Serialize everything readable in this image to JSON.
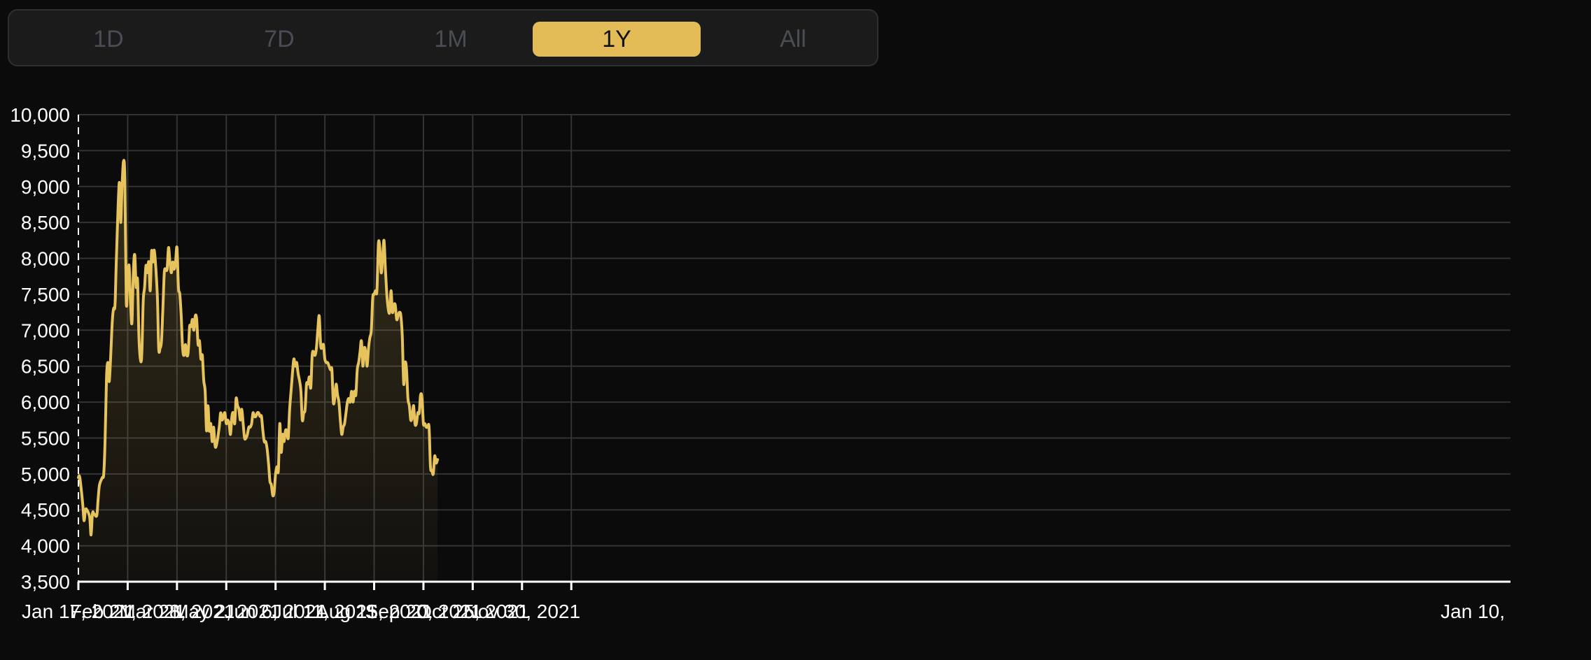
{
  "range_tabs": {
    "items": [
      {
        "label": "1D"
      },
      {
        "label": "7D"
      },
      {
        "label": "1M"
      },
      {
        "label": "1Y"
      },
      {
        "label": "All"
      }
    ],
    "active": "1Y"
  },
  "colors": {
    "line": "#e6c35c",
    "background": "#0b0b0b",
    "grid": "#333333",
    "active_tab": "#e3bc57",
    "inactive_tab_text": "#4b4d55"
  },
  "chart_data": {
    "type": "area",
    "title": "",
    "xlabel": "",
    "ylabel": "",
    "ylim": [
      3500,
      10000
    ],
    "grid": true,
    "yticks": [
      {
        "value": 10000,
        "label": "10,000"
      },
      {
        "value": 9500,
        "label": "9,500"
      },
      {
        "value": 9000,
        "label": "9,000"
      },
      {
        "value": 8500,
        "label": "8,500"
      },
      {
        "value": 8000,
        "label": "8,000"
      },
      {
        "value": 7500,
        "label": "7,500"
      },
      {
        "value": 7000,
        "label": "7,000"
      },
      {
        "value": 6500,
        "label": "6,500"
      },
      {
        "value": 6000,
        "label": "6,000"
      },
      {
        "value": 5500,
        "label": "5,500"
      },
      {
        "value": 5000,
        "label": "5,000"
      },
      {
        "value": 4500,
        "label": "4,500"
      },
      {
        "value": 4000,
        "label": "4,000"
      },
      {
        "value": 3500,
        "label": "3,500"
      }
    ],
    "xticks": [
      {
        "label": "Jan 17, 2021",
        "day": 0
      },
      {
        "label": "Feb 21, 2021",
        "day": 35
      },
      {
        "label": "Mar 28, 2021",
        "day": 70
      },
      {
        "label": "May 2, 2021",
        "day": 105
      },
      {
        "label": "Jun 6, 2021",
        "day": 140
      },
      {
        "label": "Jul 11, 2021",
        "day": 175
      },
      {
        "label": "Aug 15, 2021",
        "day": 210
      },
      {
        "label": "Sep 20, 2021",
        "day": 245
      },
      {
        "label": "Oct 25, 2021",
        "day": 280
      },
      {
        "label": "Nov 30, 2021",
        "day": 315
      },
      {
        "label": "Jan 10,",
        "day": 350
      }
    ],
    "series": [
      {
        "values": [
          [
            0,
            4950
          ],
          [
            1,
            4950
          ],
          [
            3,
            4600
          ],
          [
            4,
            4350
          ],
          [
            5,
            4500
          ],
          [
            6,
            4500
          ],
          [
            8,
            4400
          ],
          [
            9,
            4150
          ],
          [
            10,
            4450
          ],
          [
            11,
            4450
          ],
          [
            13,
            4420
          ],
          [
            14,
            4650
          ],
          [
            15,
            4850
          ],
          [
            17,
            4950
          ],
          [
            18,
            5000
          ],
          [
            19,
            5500
          ],
          [
            20,
            6350
          ],
          [
            21,
            6550
          ],
          [
            22,
            6300
          ],
          [
            24,
            7100
          ],
          [
            25,
            7300
          ],
          [
            26,
            7350
          ],
          [
            27,
            8000
          ],
          [
            29,
            9050
          ],
          [
            30,
            8500
          ],
          [
            31,
            9000
          ],
          [
            32,
            9350
          ],
          [
            33,
            9100
          ],
          [
            34,
            7400
          ],
          [
            35,
            7700
          ],
          [
            36,
            7900
          ],
          [
            37,
            7400
          ],
          [
            38,
            7100
          ],
          [
            39,
            7800
          ],
          [
            40,
            8050
          ],
          [
            41,
            7600
          ],
          [
            42,
            7700
          ],
          [
            43,
            6900
          ],
          [
            44,
            6600
          ],
          [
            45,
            6650
          ],
          [
            46,
            7400
          ],
          [
            47,
            7600
          ],
          [
            48,
            7900
          ],
          [
            49,
            7800
          ],
          [
            50,
            7950
          ],
          [
            51,
            7550
          ],
          [
            52,
            8100
          ],
          [
            53,
            7950
          ],
          [
            54,
            8100
          ],
          [
            56,
            7500
          ],
          [
            57,
            6750
          ],
          [
            58,
            6750
          ],
          [
            59,
            6850
          ],
          [
            60,
            7300
          ],
          [
            61,
            7800
          ],
          [
            62,
            7850
          ],
          [
            63,
            7850
          ],
          [
            64,
            8150
          ],
          [
            65,
            7950
          ],
          [
            66,
            7800
          ],
          [
            67,
            7950
          ],
          [
            68,
            7850
          ],
          [
            69,
            7950
          ],
          [
            70,
            8150
          ],
          [
            71,
            7600
          ],
          [
            72,
            7500
          ],
          [
            73,
            7200
          ],
          [
            74,
            6750
          ],
          [
            75,
            6650
          ],
          [
            76,
            6800
          ],
          [
            77,
            6650
          ],
          [
            78,
            6700
          ],
          [
            79,
            7050
          ],
          [
            80,
            7050
          ],
          [
            81,
            7150
          ],
          [
            82,
            7000
          ],
          [
            83,
            7200
          ],
          [
            84,
            7150
          ],
          [
            85,
            6800
          ],
          [
            86,
            6850
          ],
          [
            87,
            6600
          ],
          [
            88,
            6650
          ],
          [
            89,
            6300
          ],
          [
            90,
            6150
          ],
          [
            91,
            5600
          ],
          [
            92,
            5950
          ],
          [
            93,
            5600
          ],
          [
            94,
            5700
          ],
          [
            95,
            5450
          ],
          [
            96,
            5650
          ],
          [
            97,
            5400
          ],
          [
            98,
            5400
          ],
          [
            100,
            5650
          ],
          [
            101,
            5850
          ],
          [
            102,
            5750
          ],
          [
            103,
            5800
          ],
          [
            104,
            5850
          ],
          [
            105,
            5700
          ],
          [
            106,
            5750
          ],
          [
            107,
            5700
          ],
          [
            108,
            5550
          ],
          [
            109,
            5800
          ],
          [
            110,
            5850
          ],
          [
            111,
            5700
          ],
          [
            112,
            6050
          ],
          [
            113,
            5950
          ],
          [
            114,
            5900
          ],
          [
            115,
            5750
          ],
          [
            116,
            5900
          ],
          [
            117,
            5700
          ],
          [
            118,
            5500
          ],
          [
            119,
            5500
          ],
          [
            120,
            5550
          ],
          [
            121,
            5650
          ],
          [
            122,
            5650
          ],
          [
            123,
            5700
          ],
          [
            124,
            5850
          ],
          [
            125,
            5800
          ],
          [
            126,
            5800
          ],
          [
            127,
            5850
          ],
          [
            128,
            5850
          ],
          [
            129,
            5800
          ],
          [
            130,
            5800
          ],
          [
            131,
            5600
          ],
          [
            132,
            5450
          ],
          [
            133,
            5450
          ],
          [
            134,
            5350
          ],
          [
            135,
            5150
          ],
          [
            136,
            4900
          ],
          [
            137,
            4850
          ],
          [
            138,
            4700
          ],
          [
            139,
            4750
          ],
          [
            140,
            5000
          ],
          [
            141,
            5100
          ],
          [
            142,
            5050
          ],
          [
            143,
            5700
          ],
          [
            144,
            5300
          ],
          [
            145,
            5550
          ],
          [
            146,
            5450
          ],
          [
            147,
            5600
          ],
          [
            148,
            5600
          ],
          [
            149,
            5500
          ],
          [
            150,
            5900
          ],
          [
            151,
            6150
          ],
          [
            152,
            6400
          ],
          [
            153,
            6600
          ],
          [
            154,
            6500
          ],
          [
            155,
            6550
          ],
          [
            156,
            6400
          ],
          [
            157,
            6300
          ],
          [
            158,
            6150
          ],
          [
            159,
            5750
          ],
          [
            160,
            5850
          ],
          [
            161,
            5900
          ],
          [
            162,
            6250
          ],
          [
            163,
            6250
          ],
          [
            164,
            6350
          ],
          [
            165,
            6200
          ],
          [
            166,
            6650
          ],
          [
            167,
            6700
          ],
          [
            168,
            6650
          ],
          [
            169,
            6750
          ],
          [
            170,
            7000
          ],
          [
            171,
            7200
          ],
          [
            172,
            6800
          ],
          [
            173,
            6750
          ],
          [
            174,
            6800
          ],
          [
            175,
            6600
          ],
          [
            176,
            6550
          ],
          [
            177,
            6550
          ],
          [
            178,
            6500
          ],
          [
            179,
            6450
          ],
          [
            180,
            6450
          ],
          [
            181,
            6000
          ],
          [
            182,
            6050
          ],
          [
            183,
            6250
          ],
          [
            184,
            6100
          ],
          [
            185,
            6000
          ],
          [
            186,
            5750
          ],
          [
            187,
            5550
          ],
          [
            188,
            5650
          ],
          [
            189,
            5700
          ],
          [
            190,
            5850
          ],
          [
            191,
            6000
          ],
          [
            192,
            6050
          ],
          [
            193,
            6000
          ],
          [
            194,
            6150
          ],
          [
            195,
            6000
          ],
          [
            196,
            6150
          ],
          [
            197,
            6100
          ],
          [
            198,
            6450
          ],
          [
            199,
            6550
          ],
          [
            200,
            6700
          ],
          [
            201,
            6850
          ],
          [
            202,
            6500
          ],
          [
            203,
            6750
          ],
          [
            204,
            6700
          ],
          [
            205,
            6500
          ],
          [
            206,
            6750
          ],
          [
            207,
            6900
          ],
          [
            208,
            7000
          ],
          [
            209,
            7450
          ],
          [
            210,
            7500
          ],
          [
            211,
            7550
          ],
          [
            212,
            7550
          ],
          [
            213,
            8200
          ],
          [
            214,
            8150
          ],
          [
            215,
            7800
          ],
          [
            216,
            8000
          ],
          [
            217,
            8250
          ],
          [
            218,
            7850
          ],
          [
            219,
            7500
          ],
          [
            220,
            7300
          ],
          [
            221,
            7250
          ],
          [
            222,
            7550
          ],
          [
            223,
            7250
          ],
          [
            224,
            7350
          ],
          [
            225,
            7350
          ],
          [
            226,
            7150
          ],
          [
            227,
            7200
          ],
          [
            228,
            7250
          ],
          [
            229,
            7200
          ],
          [
            230,
            6900
          ],
          [
            231,
            6250
          ],
          [
            232,
            6550
          ],
          [
            233,
            6450
          ],
          [
            234,
            6050
          ],
          [
            235,
            5950
          ],
          [
            236,
            5750
          ],
          [
            237,
            5800
          ],
          [
            238,
            5950
          ],
          [
            239,
            5700
          ],
          [
            240,
            5700
          ],
          [
            241,
            5850
          ],
          [
            242,
            5850
          ],
          [
            243,
            6100
          ],
          [
            244,
            6050
          ],
          [
            245,
            5700
          ],
          [
            246,
            5700
          ],
          [
            247,
            5650
          ],
          [
            248,
            5650
          ],
          [
            249,
            5650
          ],
          [
            250,
            5100
          ],
          [
            251,
            5050
          ],
          [
            252,
            5000
          ],
          [
            253,
            5250
          ],
          [
            254,
            5150
          ],
          [
            255,
            5200
          ]
        ]
      }
    ]
  }
}
